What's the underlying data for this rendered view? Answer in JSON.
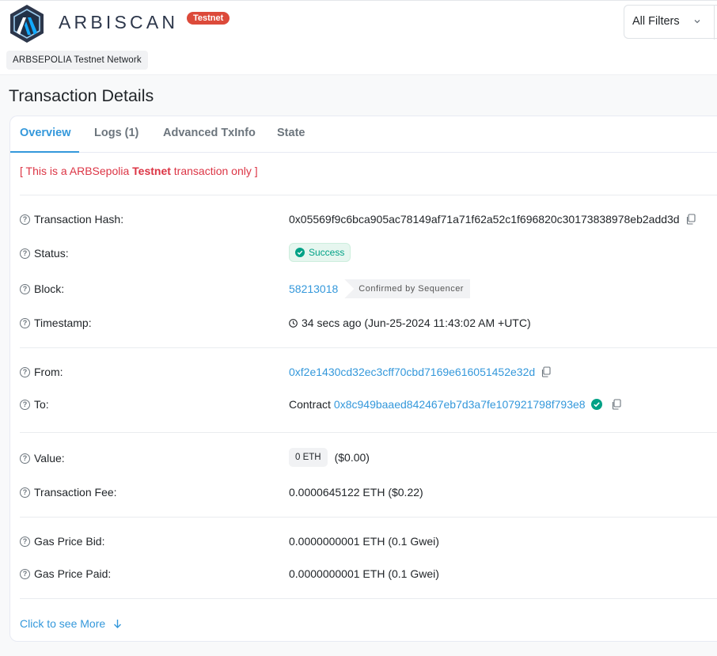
{
  "header": {
    "brand": "ARBISCAN",
    "testnet_badge": "Testnet",
    "network": "ARBSEPOLIA Testnet Network",
    "filter_label": "All Filters"
  },
  "page": {
    "title": "Transaction Details"
  },
  "tabs": [
    "Overview",
    "Logs (1)",
    "Advanced TxInfo",
    "State"
  ],
  "notice": {
    "prefix": "[ This is a ARBSepolia ",
    "bold": "Testnet",
    "suffix": " transaction only ]"
  },
  "fields": {
    "tx_hash": {
      "label": "Transaction Hash:",
      "value": "0x05569f9c6bca905ac78149af71a71f62a52c1f696820c30173838978eb2add3d"
    },
    "status": {
      "label": "Status:",
      "value": "Success"
    },
    "block": {
      "label": "Block:",
      "value": "58213018",
      "confirm": "Confirmed by Sequencer"
    },
    "timestamp": {
      "label": "Timestamp:",
      "value": "34 secs ago (Jun-25-2024 11:43:02 AM +UTC)"
    },
    "from": {
      "label": "From:",
      "value": "0xf2e1430cd32ec3cff70cbd7169e616051452e32d"
    },
    "to": {
      "label": "To:",
      "prefix": "Contract",
      "value": "0x8c949baaed842467eb7d3a7fe107921798f793e8"
    },
    "value": {
      "label": "Value:",
      "chip": "0 ETH",
      "usd": "($0.00)"
    },
    "fee": {
      "label": "Transaction Fee:",
      "value": "0.0000645122 ETH ($0.22)"
    },
    "gas_bid": {
      "label": "Gas Price Bid:",
      "value": "0.0000000001 ETH (0.1 Gwei)"
    },
    "gas_paid": {
      "label": "Gas Price Paid:",
      "value": "0.0000000001 ETH (0.1 Gwei)"
    }
  },
  "more_link": "Click to see More",
  "colors": {
    "accent": "#3498db",
    "success": "#00a186",
    "danger": "#dc3545",
    "badge": "#dc4a3a"
  }
}
